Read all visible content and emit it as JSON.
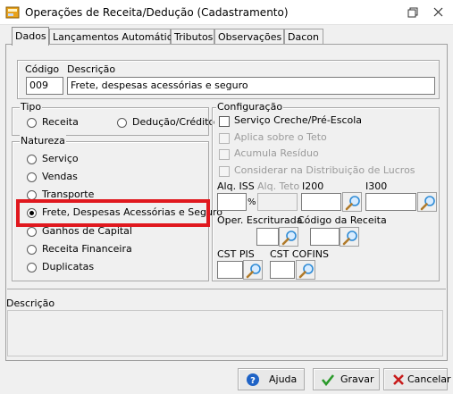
{
  "window": {
    "title": "Operações de Receita/Dedução (Cadastramento)"
  },
  "tabs": [
    {
      "label": "Dados"
    },
    {
      "label": "Lançamentos Automáticos"
    },
    {
      "label": "Tributos"
    },
    {
      "label": "Observações"
    },
    {
      "label": "Dacon"
    }
  ],
  "header": {
    "codigo_label": "Código",
    "descricao_label": "Descrição",
    "codigo_value": "009",
    "descricao_value": "Frete, despesas acessórias e seguro"
  },
  "tipo": {
    "label": "Tipo",
    "options": [
      {
        "label": "Receita",
        "selected": false
      },
      {
        "label": "Dedução/Crédito",
        "selected": false
      }
    ]
  },
  "natureza": {
    "label": "Natureza",
    "options": [
      {
        "label": "Serviço",
        "selected": false
      },
      {
        "label": "Vendas",
        "selected": false
      },
      {
        "label": "Transporte",
        "selected": false
      },
      {
        "label": "Frete, Despesas Acessórias e Seguro",
        "selected": true
      },
      {
        "label": "Ganhos de Capital",
        "selected": false
      },
      {
        "label": "Receita Financeira",
        "selected": false
      },
      {
        "label": "Duplicatas",
        "selected": false
      }
    ]
  },
  "configuracao": {
    "label": "Configuração",
    "checks": [
      {
        "label": "Serviço Creche/Pré-Escola",
        "enabled": true,
        "checked": false
      },
      {
        "label": "Aplica sobre o Teto",
        "enabled": false,
        "checked": false
      },
      {
        "label": "Acumula Resíduo",
        "enabled": false,
        "checked": false
      },
      {
        "label": "Considerar na Distribuição de Lucros",
        "enabled": false,
        "checked": false
      }
    ],
    "fields": {
      "aliq_iss": "Alq. ISS",
      "aliq_teto": "Alq. Teto",
      "i200": "I200",
      "i300": "I300",
      "percent": "%",
      "oper_escriturada": "Oper. Escriturada",
      "codigo_receita": "Código da Receita",
      "cst_pis": "CST PIS",
      "cst_cofins": "CST COFINS"
    }
  },
  "descricao_group": {
    "label": "Descrição"
  },
  "buttons": {
    "ajuda": "Ajuda",
    "gravar": "Gravar",
    "cancelar": "Cancelar"
  },
  "colors": {
    "highlight": "#e0181e",
    "search_lens": "#2e8bd6",
    "ok_check": "#2a9a2a",
    "cancel_x": "#c81b1b",
    "help_blue": "#1f63c6"
  },
  "icons": [
    "app-icon",
    "restore-icon",
    "close-icon",
    "search-icon",
    "help-icon",
    "checkmark-icon",
    "cancel-x-icon"
  ]
}
